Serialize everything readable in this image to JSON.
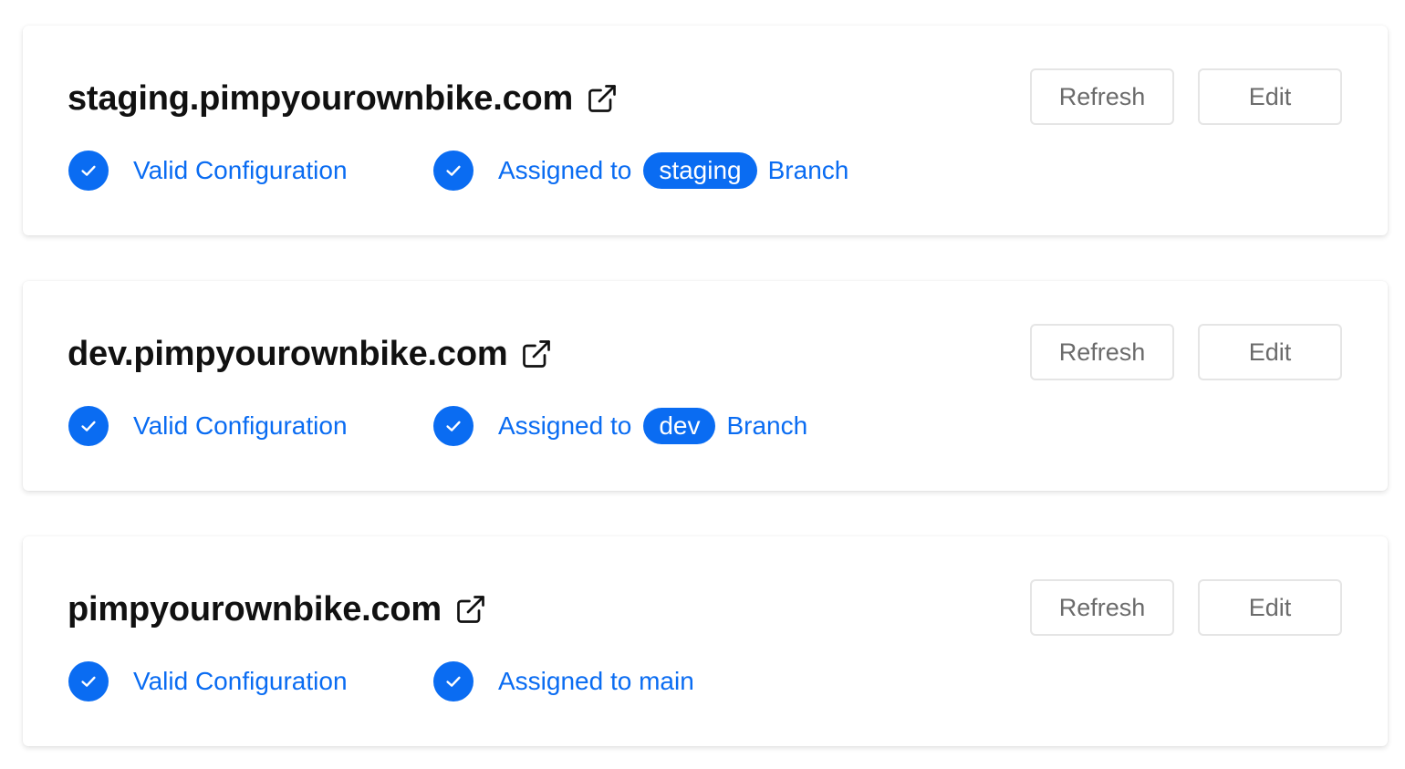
{
  "domains": [
    {
      "name": "staging.pimpyourownbike.com",
      "status_valid": "Valid Configuration",
      "assigned_prefix": "Assigned to",
      "branch": "staging",
      "assigned_suffix": "Branch",
      "refresh_label": "Refresh",
      "edit_label": "Edit"
    },
    {
      "name": "dev.pimpyourownbike.com",
      "status_valid": "Valid Configuration",
      "assigned_prefix": "Assigned to",
      "branch": "dev",
      "assigned_suffix": "Branch",
      "refresh_label": "Refresh",
      "edit_label": "Edit"
    },
    {
      "name": "pimpyourownbike.com",
      "status_valid": "Valid Configuration",
      "assigned_prefix": "Assigned to main",
      "refresh_label": "Refresh",
      "edit_label": "Edit"
    }
  ],
  "icons": {
    "external_link": "external-link-icon",
    "check": "check-circle-icon"
  },
  "colors": {
    "accent": "#0a6cf2",
    "title": "#111111",
    "button_text": "#6b6b6b",
    "button_border": "#e5e5e5"
  }
}
